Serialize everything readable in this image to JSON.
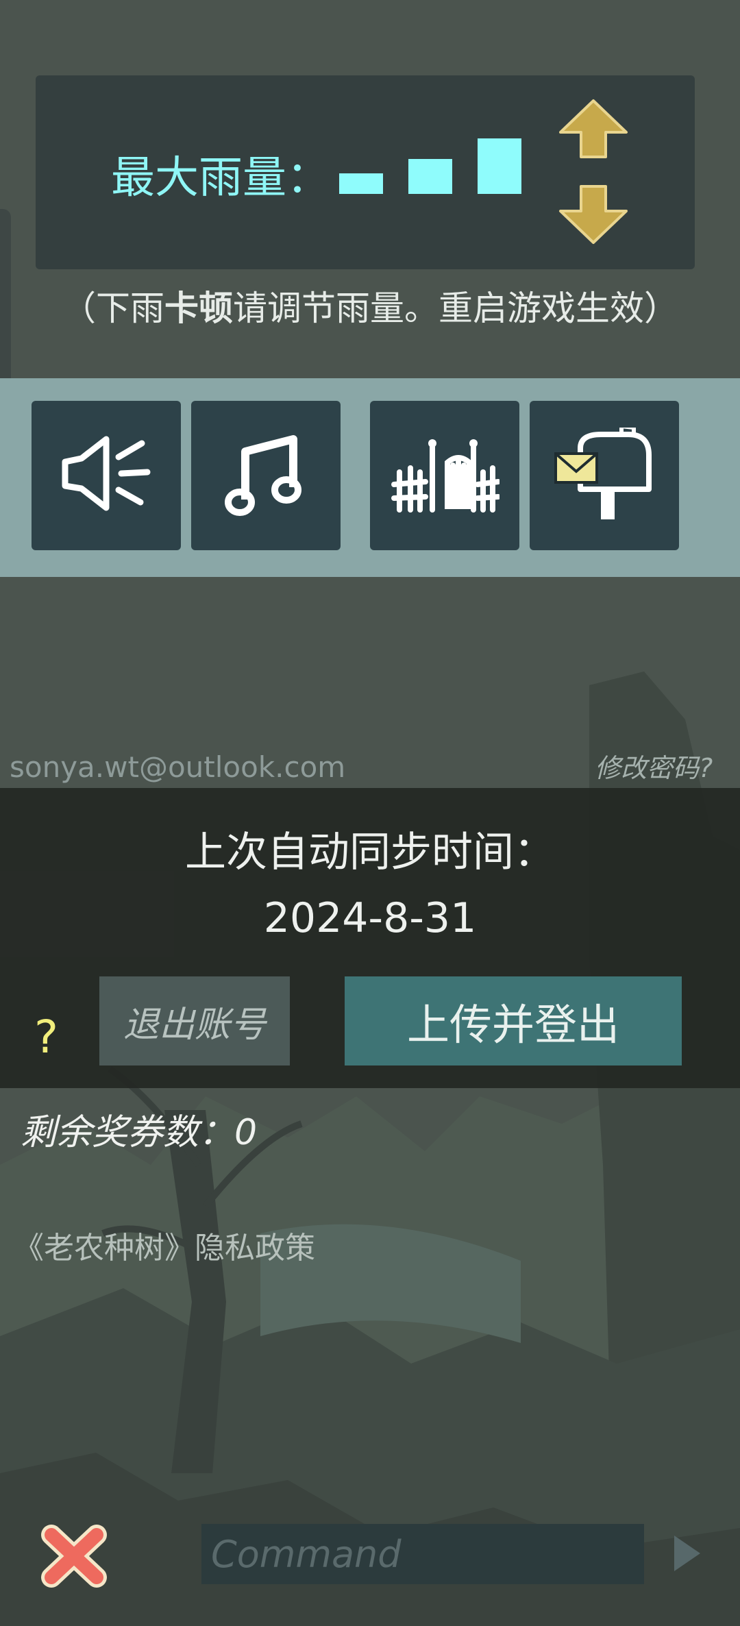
{
  "rain_settings": {
    "label": "最大雨量：",
    "level": 3,
    "max_level": 3,
    "note_prefix": "（下雨",
    "note_bold": "卡顿",
    "note_suffix": "请调节雨量。重启游戏生效）"
  },
  "toolbar": {
    "buttons": [
      {
        "icon": "speaker-icon"
      },
      {
        "icon": "music-note-icon"
      },
      {
        "icon": "fence-gate-icon"
      },
      {
        "icon": "mailbox-icon"
      }
    ]
  },
  "account": {
    "email": "sonya.wt@outlook.com",
    "change_password": "修改密码?",
    "sync_title": "上次自动同步时间：",
    "sync_date": "2024-8-31",
    "logout_label": "退出账号",
    "upload_logout_label": "上传并登出",
    "help": "?"
  },
  "tickets_label": "剩余奖券数：0",
  "privacy_link": "《老农种树》隐私政策",
  "command": {
    "placeholder": "Command",
    "value": ""
  },
  "colors": {
    "rain_accent": "#8ffcfc",
    "arrow": "#c7a94b",
    "upload_button": "#3e7475",
    "help": "#f1ee7c",
    "close": "#ee6a5e"
  }
}
